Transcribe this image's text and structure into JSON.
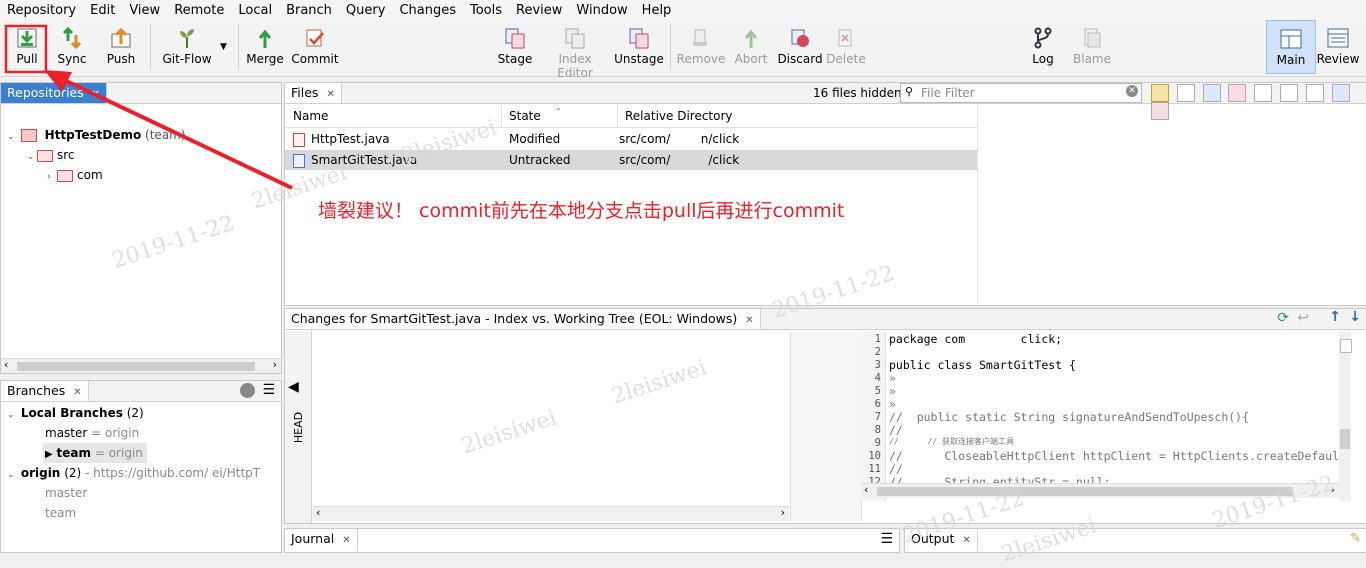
{
  "menu": [
    "Repository",
    "Edit",
    "View",
    "Remote",
    "Local",
    "Branch",
    "Query",
    "Changes",
    "Tools",
    "Review",
    "Window",
    "Help"
  ],
  "toolbar": {
    "pull": "Pull",
    "sync": "Sync",
    "push": "Push",
    "gitflow": "Git-Flow",
    "merge": "Merge",
    "commit": "Commit",
    "stage": "Stage",
    "index_editor": "Index Editor",
    "unstage": "Unstage",
    "remove": "Remove",
    "abort": "Abort",
    "discard": "Discard",
    "delete": "Delete",
    "log": "Log",
    "blame": "Blame",
    "main": "Main",
    "review": "Review"
  },
  "repos": {
    "tab": "Repositories",
    "repo_name": "HttpTestDemo",
    "repo_tag": "(team)",
    "src": "src",
    "com": "com"
  },
  "files": {
    "tab": "Files",
    "hidden": "16 files hidden",
    "filter_placeholder": "File Filter",
    "columns": [
      "Name",
      "State",
      "Relative Directory"
    ],
    "rows": [
      {
        "name": "HttpTest.java",
        "state": "Modified",
        "dir": "src/com/        n/click"
      },
      {
        "name": "SmartGitTest.java",
        "state": "Untracked",
        "dir": "src/com/          /click"
      }
    ]
  },
  "annotation": "墙裂建议！ commit前先在本地分支点击pull后再进行commit",
  "branches": {
    "tab": "Branches",
    "local_label": "Local Branches",
    "local_count": "(2)",
    "master": "master",
    "master_track": "= origin",
    "team": "team",
    "team_track": "= origin",
    "origin_label": "origin",
    "origin_count": "(2)",
    "origin_url": "- https://github.com/        ei/HttpT",
    "origin_master": "master",
    "origin_team": "team"
  },
  "changes": {
    "tab": "Changes for SmartGitTest.java - Index vs. Working Tree (EOL: Windows)",
    "head": "HEAD",
    "lines": [
      "1",
      "2",
      "3",
      "4",
      "5",
      "6",
      "7",
      "8",
      "9",
      "10",
      "11",
      "12"
    ],
    "code": [
      "package com        click;",
      "",
      "public class SmartGitTest {",
      "»",
      "»",
      "»",
      "//  public static String signatureAndSendToUpesch(){",
      "//",
      "//      // 获取连接客户端工具",
      "//      CloseableHttpClient httpClient = HttpClients.createDefaul",
      "//",
      "//      String entityStr = null;"
    ]
  },
  "bottom": {
    "journal": "Journal",
    "output": "Output"
  },
  "watermarks": [
    "2leisiwei",
    "2019-11-22",
    "2leisiwei",
    "2019-11-22",
    "2leisiwei",
    "2leisiwei",
    "2019-11-22",
    "2019-11-22",
    "2leisiwei"
  ],
  "colors": {
    "accent": "#3a7fd0",
    "annotation": "#e8212b"
  }
}
